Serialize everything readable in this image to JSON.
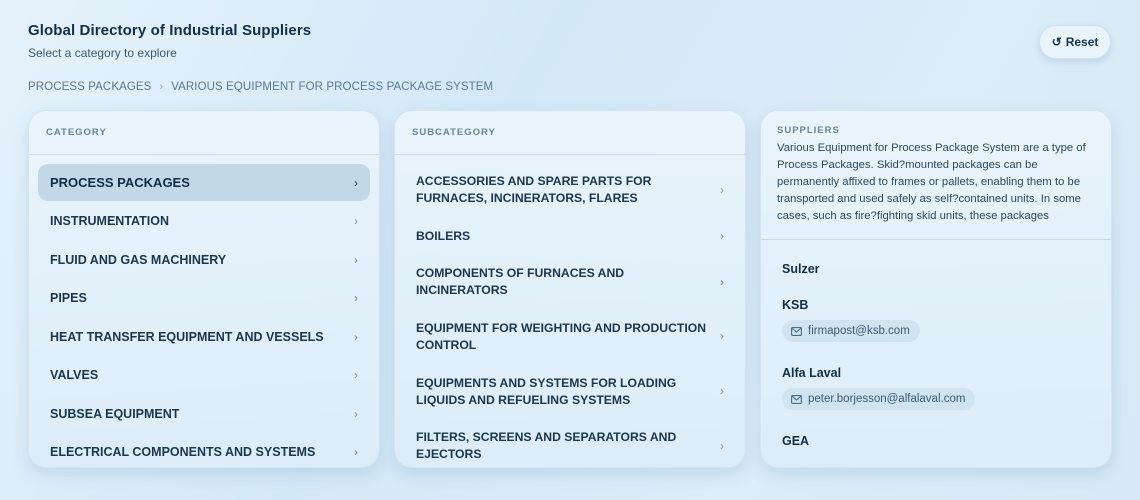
{
  "header": {
    "title": "Global Directory of Industrial Suppliers",
    "subtitle": "Select a category to explore",
    "reset_label": "Reset",
    "reset_icon": "↺"
  },
  "breadcrumb": [
    "PROCESS PACKAGES",
    "VARIOUS EQUIPMENT FOR PROCESS PACKAGE SYSTEM"
  ],
  "category_panel": {
    "heading": "CATEGORY",
    "items": [
      {
        "label": "PROCESS PACKAGES",
        "active": true
      },
      {
        "label": "INSTRUMENTATION",
        "active": false
      },
      {
        "label": "FLUID AND GAS MACHINERY",
        "active": false
      },
      {
        "label": "PIPES",
        "active": false
      },
      {
        "label": "HEAT TRANSFER EQUIPMENT AND VESSELS",
        "active": false
      },
      {
        "label": "VALVES",
        "active": false
      },
      {
        "label": "SUBSEA EQUIPMENT",
        "active": false
      },
      {
        "label": "ELECTRICAL COMPONENTS AND SYSTEMS",
        "active": false
      }
    ]
  },
  "subcategory_panel": {
    "heading": "SUBCATEGORY",
    "items": [
      {
        "label": "ACCESSORIES AND SPARE PARTS FOR FURNACES, INCINERATORS, FLARES"
      },
      {
        "label": "BOILERS"
      },
      {
        "label": "COMPONENTS OF FURNACES AND INCINERATORS"
      },
      {
        "label": "EQUIPMENT FOR WEIGHTING AND PRODUCTION CONTROL"
      },
      {
        "label": "EQUIPMENTS AND SYSTEMS FOR LOADING LIQUIDS AND REFUELING SYSTEMS"
      },
      {
        "label": "FILTERS, SCREENS AND SEPARATORS AND EJECTORS"
      }
    ]
  },
  "suppliers_panel": {
    "heading": "SUPPLIERS",
    "description": "Various Equipment for Process Package System are a type of Process Packages. Skid?mounted packages can be permanently affixed to frames or pallets, enabling them to be transported and used safely as self?contained units. In some cases, such as fire?fighting skid units, these packages",
    "suppliers": [
      {
        "name": "Sulzer",
        "email": ""
      },
      {
        "name": "KSB",
        "email": "firmapost@ksb.com"
      },
      {
        "name": "Alfa Laval",
        "email": "peter.borjesson@alfalaval.com"
      },
      {
        "name": "GEA",
        "email": ""
      }
    ]
  },
  "icons": {
    "chevron": "›",
    "mail": "mail-icon"
  },
  "colors": {
    "active_row": "#c3d8e7",
    "chip": "#d0e3f0",
    "title": "#10304c"
  }
}
